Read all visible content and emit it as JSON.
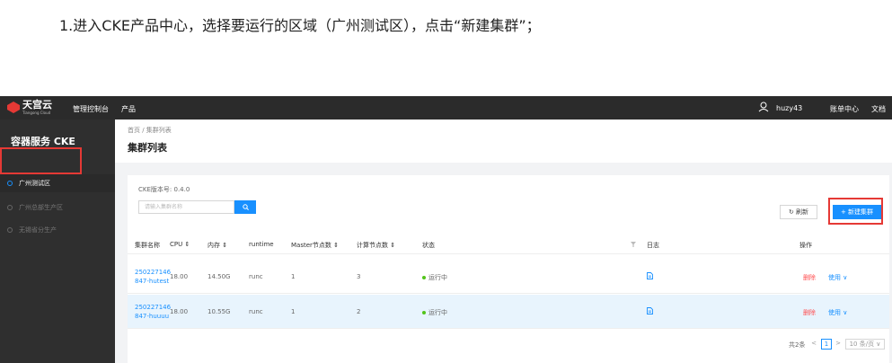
{
  "instruction": "1.进入CKE产品中心，选择要运行的区域（广州测试区），点击“新建集群”；",
  "topbar": {
    "logo_text": "天宫云",
    "logo_sub": "Tiangong Cloud",
    "console": "管理控制台",
    "products": "产品",
    "user": "huzy43",
    "bill": "账单中心",
    "docs": "文档",
    "brand_color": "#e53935"
  },
  "sidebar": {
    "title": "容器服务 CKE",
    "items": [
      {
        "label": "广州测试区",
        "active": true
      },
      {
        "label": "广州总部生产区",
        "active": false
      },
      {
        "label": "无锡省分生产",
        "active": false
      }
    ]
  },
  "page": {
    "breadcrumb": "首页 / 集群列表",
    "title": "集群列表"
  },
  "toolbar": {
    "version": "CKE版本号: 0.4.0",
    "search_placeholder": "请输入集群名称",
    "refresh_label": "刷新",
    "new_cluster_label": "+ 新建集群"
  },
  "table": {
    "headers": {
      "name": "集群名称",
      "cpu": "CPU ⇕",
      "memory": "内存 ⇕",
      "runtime": "runtime",
      "master": "Master节点数 ⇕",
      "compute": "计算节点数 ⇕",
      "status": "状态",
      "logs": "日志",
      "actions": "操作"
    },
    "rows": [
      {
        "name_l1": "250227146",
        "name_l2": "847-hutest",
        "cpu": "18.00",
        "memory": "14.50G",
        "runtime": "runc",
        "master": "1",
        "compute": "3",
        "status": "运行中",
        "del": "删除",
        "use": "使用 ∨"
      },
      {
        "name_l1": "250227146",
        "name_l2": "847-huuuu",
        "cpu": "18.00",
        "memory": "10.55G",
        "runtime": "runc",
        "master": "1",
        "compute": "2",
        "status": "运行中",
        "del": "删除",
        "use": "使用 ∨"
      }
    ]
  },
  "pagination": {
    "total": "共2条",
    "prev": "<",
    "current": "1",
    "next": ">",
    "page_size": "10 条/页 ∨"
  }
}
